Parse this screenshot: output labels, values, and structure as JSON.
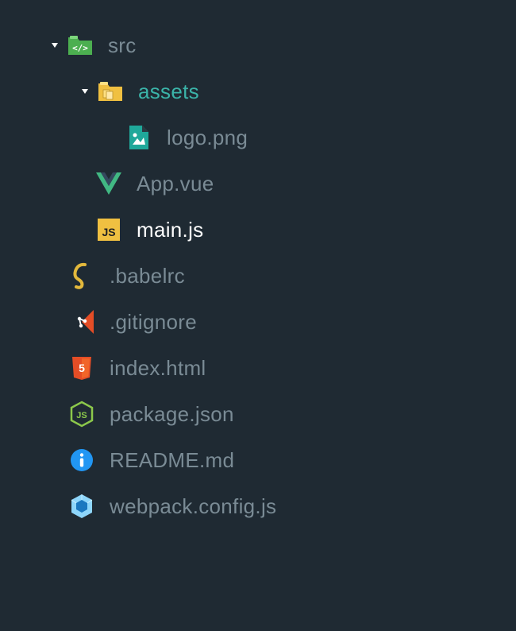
{
  "tree": {
    "src": {
      "label": "src",
      "expanded": true,
      "children": {
        "assets": {
          "label": "assets",
          "expanded": true,
          "children": {
            "logo": {
              "label": "logo.png"
            }
          }
        },
        "appvue": {
          "label": "App.vue"
        },
        "mainjs": {
          "label": "main.js"
        }
      }
    },
    "babelrc": {
      "label": ".babelrc"
    },
    "gitignore": {
      "label": ".gitignore"
    },
    "indexhtml": {
      "label": "index.html"
    },
    "packagejson": {
      "label": "package.json"
    },
    "readme": {
      "label": "README.md"
    },
    "webpackconfig": {
      "label": "webpack.config.js"
    }
  },
  "colors": {
    "folder_src": "#4caf50",
    "folder_assets": "#f0c041",
    "image": "#1fa89a",
    "vue": "#41b883",
    "js_bg": "#f0c041",
    "js_fg": "#222",
    "babel": "#e2b83c",
    "git": "#e44d26",
    "html5": "#e44d26",
    "node": "#8cc84b",
    "info_bg": "#2196f3",
    "webpack_cube": "#8ed6fb",
    "webpack_inner": "#1c78c0",
    "text_muted": "#7a8b95"
  }
}
